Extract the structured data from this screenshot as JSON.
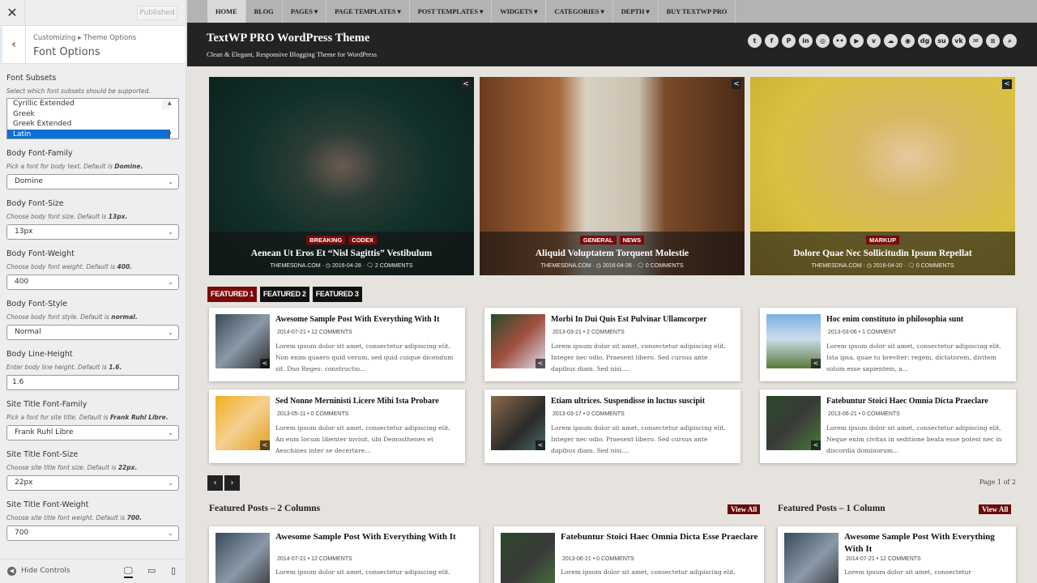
{
  "sidebar": {
    "close": "✕",
    "published": "Published",
    "breadcrumb": "Customizing ▸ Theme Options",
    "title": "Font Options",
    "font_subsets": {
      "label": "Font Subsets",
      "desc": "Select which font subsets should be supported.",
      "options": [
        "Cyrillic Extended",
        "Greek",
        "Greek Extended",
        "Latin"
      ],
      "selected": "Latin"
    },
    "controls": [
      {
        "label": "Body Font-Family",
        "desc": "Pick a font for body text. Default is ",
        "def": "Domine.",
        "value": "Domine",
        "type": "select"
      },
      {
        "label": "Body Font-Size",
        "desc": "Choose body font size. Default is ",
        "def": "13px.",
        "value": "13px",
        "type": "select"
      },
      {
        "label": "Body Font-Weight",
        "desc": "Choose body font weight. Default is ",
        "def": "400.",
        "value": "400",
        "type": "select"
      },
      {
        "label": "Body Font-Style",
        "desc": "Choose body font style. Default is ",
        "def": "normal.",
        "value": "Normal",
        "type": "select"
      },
      {
        "label": "Body Line-Height",
        "desc": "Enter body line height. Default is ",
        "def": "1.6.",
        "value": "1.6",
        "type": "input"
      },
      {
        "label": "Site Title Font-Family",
        "desc": "Pick a font for site title. Default is ",
        "def": "Frank Ruhl Libre.",
        "value": "Frank Ruhl Libre",
        "type": "select"
      },
      {
        "label": "Site Title Font-Size",
        "desc": "Choose site title font size. Default is ",
        "def": "22px.",
        "value": "22px",
        "type": "select"
      },
      {
        "label": "Site Title Font-Weight",
        "desc": "Choose site title font weight. Default is ",
        "def": "700.",
        "value": "700",
        "type": "select"
      }
    ],
    "hide_controls": "Hide Controls"
  },
  "nav": [
    "HOME",
    "BLOG",
    "PAGES ▾",
    "PAGE TEMPLATES ▾",
    "POST TEMPLATES ▾",
    "WIDGETS ▾",
    "CATEGORIES ▾",
    "DEPTH ▾",
    "BUY TEXTWP PRO"
  ],
  "header": {
    "title": "TextWP PRO WordPress Theme",
    "tagline": "Clean & Elegant, Responsive Blogging Theme for WordPress",
    "social": [
      "twitter",
      "facebook",
      "pinterest",
      "linkedin",
      "instagram",
      "flickr",
      "youtube",
      "vimeo",
      "soundcloud",
      "github",
      "digg",
      "stumbleupon",
      "vk",
      "email",
      "rss",
      "search"
    ]
  },
  "slides": [
    {
      "cats": [
        "BREAKING",
        "CODEX"
      ],
      "title": "Aenean Ut Eros Et “Nisl Sagittis” Vestibulum",
      "author": "THEMESDNA.COM",
      "date": "2016-04-28",
      "comments": "2 COMMENTS"
    },
    {
      "cats": [
        "GENERAL",
        "NEWS"
      ],
      "title": "Aliquid Voluptatem Torquent Molestie",
      "author": "THEMESDNA.COM",
      "date": "2016-04-26",
      "comments": "0 COMMENTS"
    },
    {
      "cats": [
        "MARKUP"
      ],
      "title": "Dolore Quae Nec Sollicitudin Ipsum Repellat",
      "author": "THEMESDNA.COM",
      "date": "2016-04-20",
      "comments": "0 COMMENTS"
    }
  ],
  "tabs": [
    "FEATURED 1",
    "FEATURED 2",
    "FEATURED 3"
  ],
  "posts": [
    {
      "title": "Awesome Sample Post With Everything With It",
      "date": "2014-07-21",
      "comments": "12 COMMENTS",
      "excerpt": "Lorem ipsum dolor sit amet, consectetur adipiscing elit. Non enim quaero quid verum, sed quid cuique dicendum sit. Duo Reges: constructio..."
    },
    {
      "title": "Morbi In Dui Quis Est Pulvinar Ullamcorper",
      "date": "2013-03-21",
      "comments": "2 COMMENTS",
      "excerpt": "Lorem ipsum dolor sit amet, consectetur adipiscing elit. Integer nec odio. Praesent libero. Sed cursus ante dapibus diam. Sed nisi...."
    },
    {
      "title": "Hoc enim constituto in philosophia sunt",
      "date": "2013-03-06",
      "comments": "1 COMMENT",
      "excerpt": "Lorem ipsum dolor sit amet, consectetur adipiscing elit. Ista ipsa, quae tu breviter: regem, dictatorem, divitem solum esse sapientem, a..."
    },
    {
      "title": "Sed Nonne Merninisti Licere Mihi Ista Probare",
      "date": "2013-05-11",
      "comments": "0 COMMENTS",
      "excerpt": "Lorem ipsum dolor sit amet, consectetur adipiscing elit. An eum locum libenter invisit, ubi Demosthenes et Aeschines inter se decertare..."
    },
    {
      "title": "Etiam ultrices. Suspendisse in luctus suscipit",
      "date": "2013-03-17",
      "comments": "0 COMMENTS",
      "excerpt": "Lorem ipsum dolor sit amet, consectetur adipiscing elit. Integer nec odio. Praesent libero. Sed cursus ante dapibus diam. Sed nisi...."
    },
    {
      "title": "Fatebuntur Stoici Haec Omnia Dicta Praeclare",
      "date": "2013-06-21",
      "comments": "0 COMMENTS",
      "excerpt": "Lorem ipsum dolor sit amet, consectetur adipiscing elit. Neque enim civitas in seditione beata esse potest nec in discordia dominorum..."
    }
  ],
  "pagination": {
    "prev": "‹",
    "next": "›",
    "page": "Page 1 of 2"
  },
  "sections": [
    {
      "title": "Featured Posts – 2 Columns",
      "view_all": "View All",
      "posts": [
        {
          "title": "Awesome Sample Post With Everything With It",
          "date": "2014-07-21",
          "comments": "12 COMMENTS",
          "excerpt": "Lorem ipsum dolor sit amet, consectetur adipiscing elit."
        },
        {
          "title": "Fatebuntur Stoici Haec Omnia Dicta Esse Praeclare",
          "date": "2013-06-21",
          "comments": "0 COMMENTS",
          "excerpt": "Lorem ipsum dolor sit amet, consectetur adipiscing elit."
        }
      ]
    },
    {
      "title": "Featured Posts – 1 Column",
      "view_all": "View All",
      "posts": [
        {
          "title": "Awesome Sample Post With Everything With It",
          "date": "2014-07-21",
          "comments": "12 COMMENTS",
          "excerpt": "Lorem ipsum dolor sit amet, consectetur"
        }
      ]
    }
  ],
  "colors": {
    "accent": "#7a0a0a",
    "header": "#232323",
    "nav": "#b3b3b3"
  }
}
